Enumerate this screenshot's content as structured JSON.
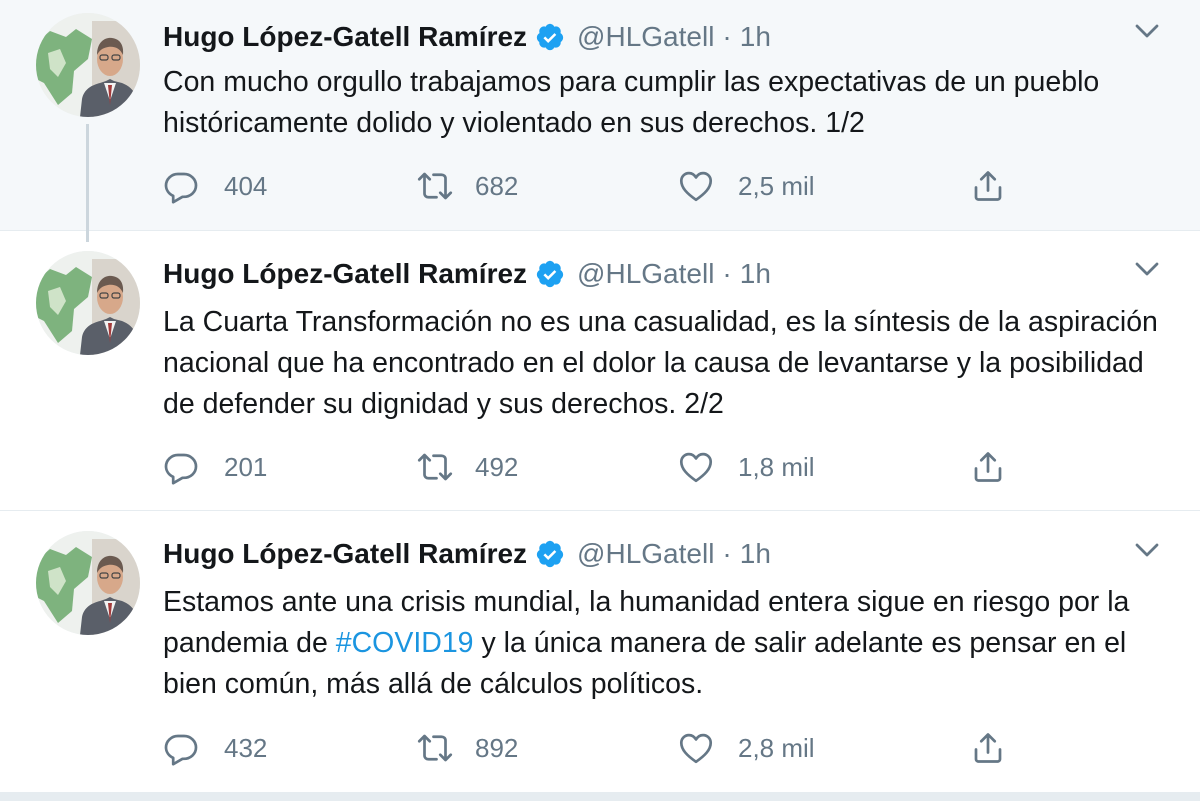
{
  "tweets": [
    {
      "author_name": "Hugo López-Gatell Ramírez",
      "handle": "@HLGatell",
      "separator": "·",
      "time": "1h",
      "text_before": "Con mucho orgullo trabajamos para cumplir las expectativas de un pueblo históricamente dolido y violentado en sus derechos. 1/2",
      "hashtag": "",
      "text_after": "",
      "replies": "404",
      "retweets": "682",
      "likes": "2,5 mil"
    },
    {
      "author_name": "Hugo López-Gatell Ramírez",
      "handle": "@HLGatell",
      "separator": "·",
      "time": "1h",
      "text_before": "La Cuarta Transformación no es una casualidad, es la síntesis de la aspiración nacional que ha encontrado en el dolor la causa de levantarse y la posibilidad de defender su dignidad y sus derechos. 2/2",
      "hashtag": "",
      "text_after": "",
      "replies": "201",
      "retweets": "492",
      "likes": "1,8 mil"
    },
    {
      "author_name": "Hugo López-Gatell Ramírez",
      "handle": "@HLGatell",
      "separator": "·",
      "time": "1h",
      "text_before": "Estamos ante una crisis mundial, la humanidad entera sigue en riesgo por la pandemia de ",
      "hashtag": "#COVID19",
      "text_after": " y la única manera de salir adelante es pensar en el bien común, más allá de cálculos políticos.",
      "replies": "432",
      "retweets": "892",
      "likes": "2,8 mil"
    }
  ],
  "icons": {
    "verified": "verified-badge-icon",
    "caret": "chevron-down-icon",
    "reply": "reply-icon",
    "retweet": "retweet-icon",
    "like": "heart-icon",
    "share": "share-icon"
  },
  "colors": {
    "accent": "#1da1f2",
    "hashtag": "#1b95e0",
    "secondary_text": "#657786",
    "highlight_background": "#f5f8fa"
  }
}
